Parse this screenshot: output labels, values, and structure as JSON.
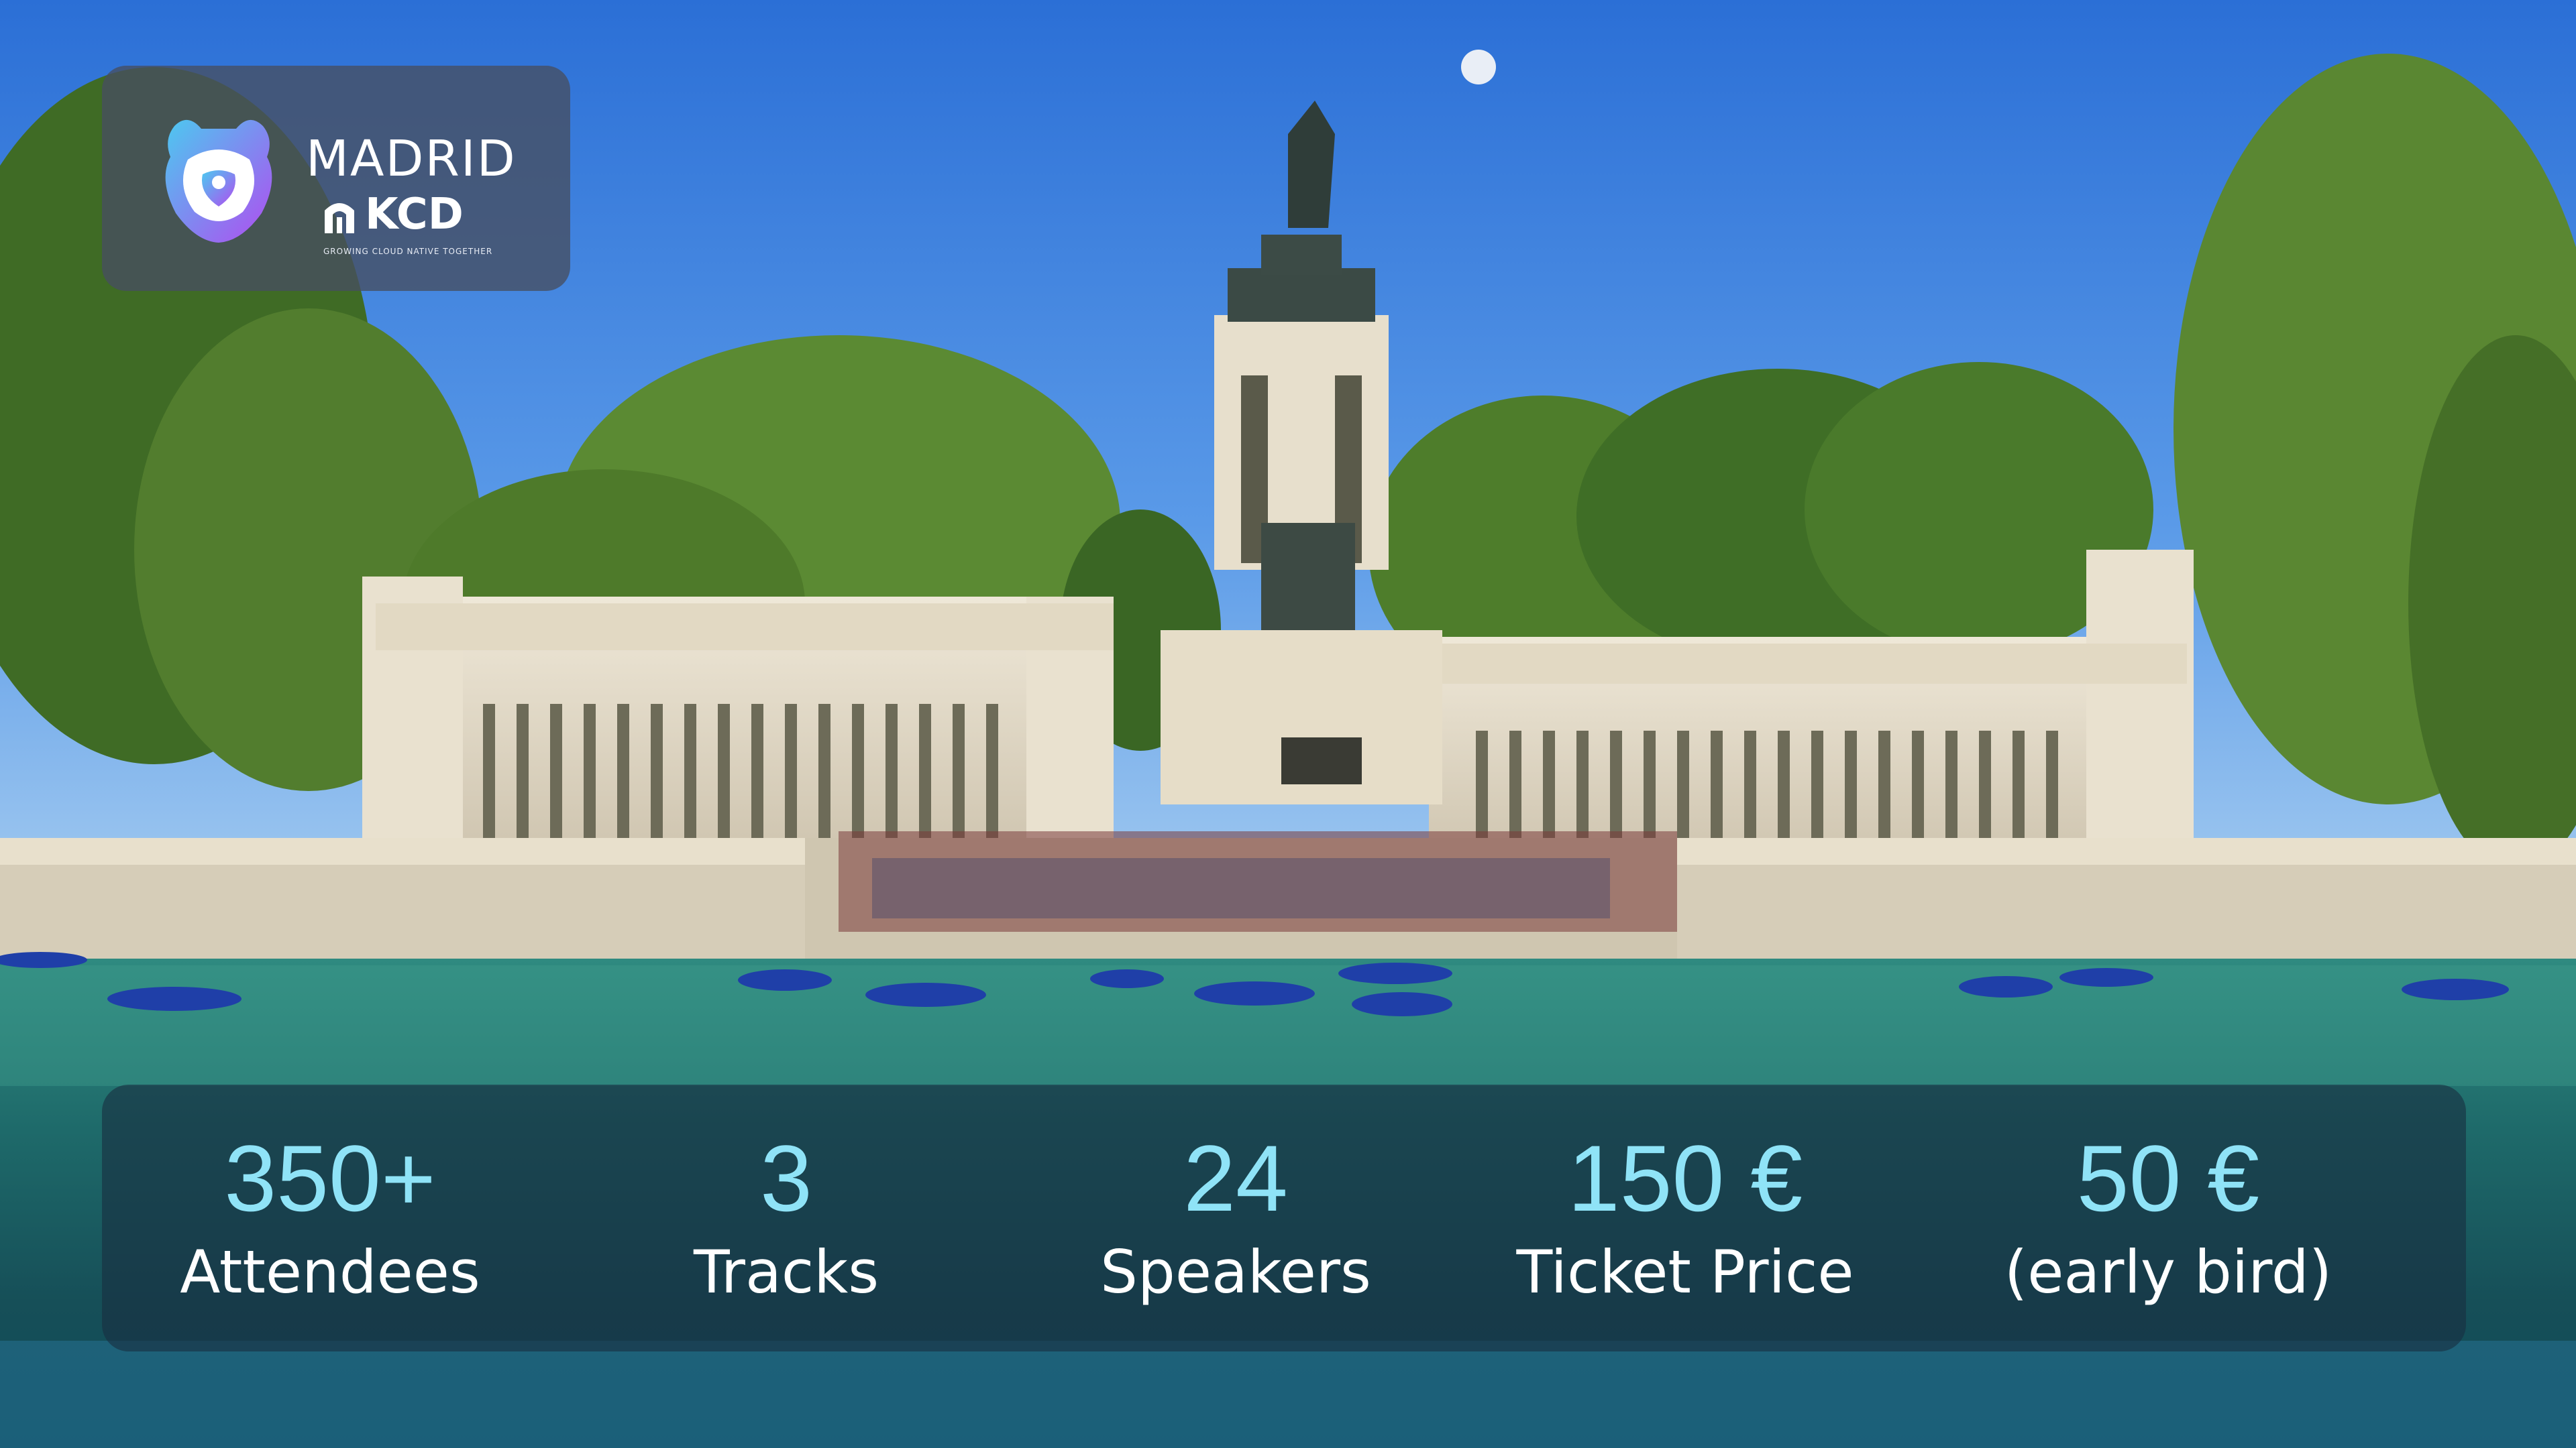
{
  "logo": {
    "city": "MADRID",
    "brand": "KCD",
    "tagline": "GROWING CLOUD NATIVE TOGETHER"
  },
  "stats": [
    {
      "value": "350+",
      "label": "Attendees"
    },
    {
      "value": "3",
      "label": "Tracks"
    },
    {
      "value": "24",
      "label": "Speakers"
    },
    {
      "value": "150 €",
      "label": "Ticket Price"
    },
    {
      "value": "50 €",
      "label": "(early bird)"
    }
  ],
  "colors": {
    "stat_value": "#8fe3f7",
    "stat_label": "#ffffff",
    "bear_gradient_start": "#4cc9f0",
    "bear_gradient_end": "#b14cf0"
  }
}
